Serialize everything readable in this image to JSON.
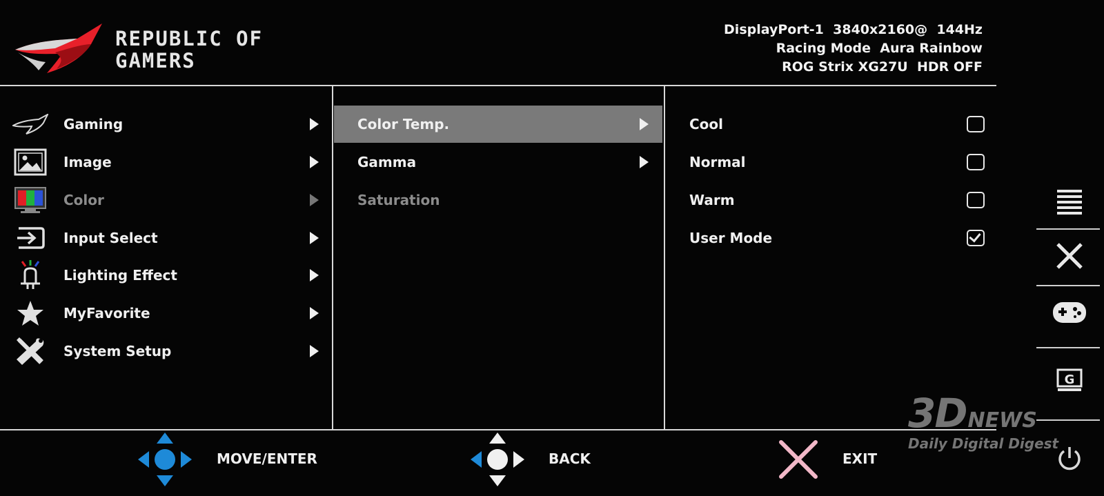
{
  "brand": {
    "line1": "REPUBLIC OF",
    "line2": "GAMERS"
  },
  "status": {
    "line1": "DisplayPort-1  3840x2160@  144Hz",
    "line2": "Racing Mode  Aura Rainbow",
    "line3": "ROG Strix XG27U  HDR OFF"
  },
  "menu": {
    "items": [
      {
        "label": "Gaming",
        "icon": "rog-eye-icon"
      },
      {
        "label": "Image",
        "icon": "image-icon"
      },
      {
        "label": "Color",
        "icon": "color-monitor-icon"
      },
      {
        "label": "Input Select",
        "icon": "input-icon"
      },
      {
        "label": "Lighting Effect",
        "icon": "lighting-icon"
      },
      {
        "label": "MyFavorite",
        "icon": "star-icon"
      },
      {
        "label": "System Setup",
        "icon": "tools-icon"
      }
    ]
  },
  "submenu": {
    "items": [
      {
        "label": "Color Temp."
      },
      {
        "label": "Gamma"
      },
      {
        "label": "Saturation"
      }
    ]
  },
  "options": {
    "items": [
      {
        "label": "Cool",
        "checked": false
      },
      {
        "label": "Normal",
        "checked": false
      },
      {
        "label": "Warm",
        "checked": false
      },
      {
        "label": "User Mode",
        "checked": true
      }
    ]
  },
  "footer": {
    "move_label": "MOVE/ENTER",
    "back_label": "BACK",
    "exit_label": "EXIT"
  },
  "watermark": {
    "big": "3D",
    "news": "NEWS",
    "sub": "Daily Digital Digest"
  },
  "colors": {
    "accent_red": "#e8202a",
    "nav_blue": "#1e8ad8",
    "exit_pink": "#f2b8c8",
    "highlight": "#7a7a7a"
  }
}
